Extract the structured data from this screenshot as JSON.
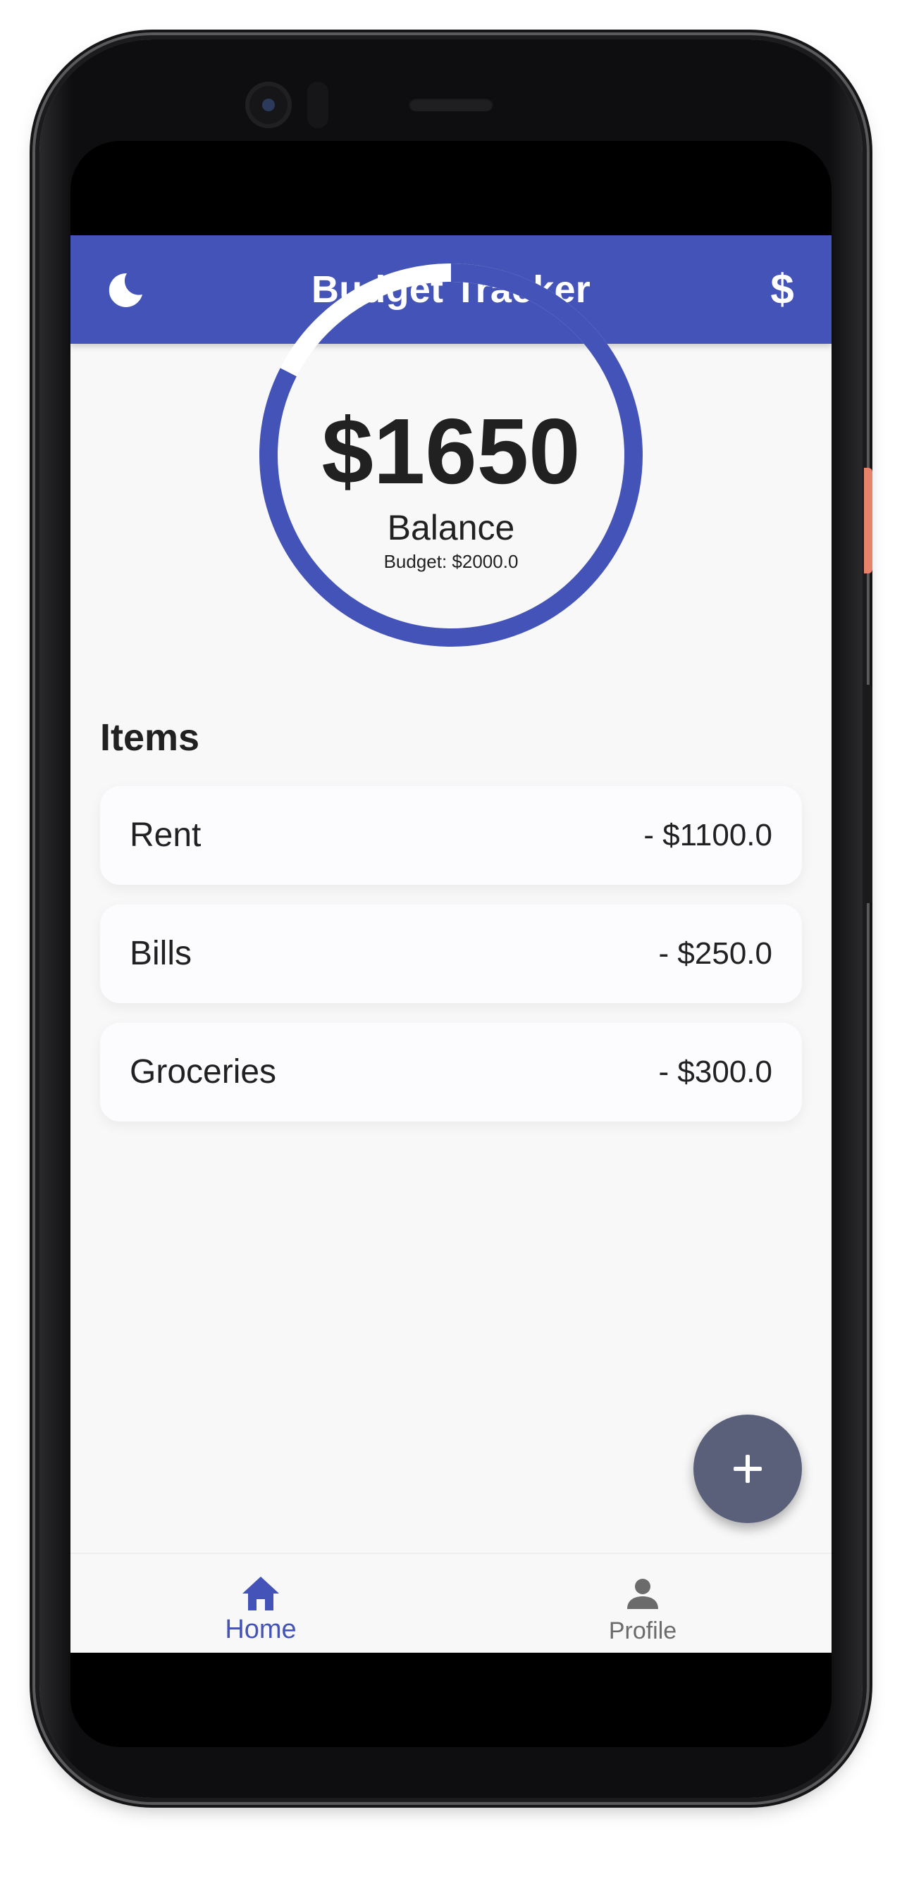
{
  "app": {
    "title": "Budget Tracker",
    "theme_toggle_icon": "moon-icon",
    "currency_icon": "dollar-icon",
    "currency_symbol": "$",
    "accent_color": "#4353b8"
  },
  "summary": {
    "balance": "$1650",
    "balance_label": "Balance",
    "budget_text": "Budget: $2000.0",
    "remaining_fraction": 0.825
  },
  "items_section": {
    "heading": "Items",
    "items": [
      {
        "name": "Rent",
        "amount": "- $1100.0"
      },
      {
        "name": "Bills",
        "amount": "- $250.0"
      },
      {
        "name": "Groceries",
        "amount": "- $300.0"
      }
    ]
  },
  "fab": {
    "icon": "plus-icon"
  },
  "bottom_nav": {
    "items": [
      {
        "label": "Home",
        "icon": "home-icon",
        "active": true
      },
      {
        "label": "Profile",
        "icon": "person-icon",
        "active": false
      }
    ]
  }
}
